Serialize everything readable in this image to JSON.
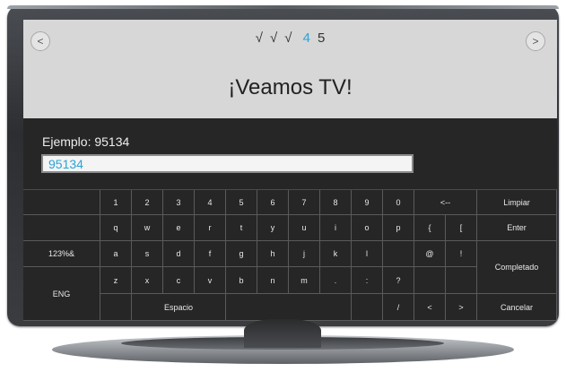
{
  "steps": [
    "√",
    "√",
    "√",
    "4",
    "5"
  ],
  "current_step": "4",
  "nav": {
    "prev": "<",
    "next": ">"
  },
  "title": "¡Veamos TV!",
  "example": "Ejemplo: 95134",
  "code_value": "95134",
  "keys": [
    [
      "",
      "1",
      "2",
      "3",
      "4",
      "5",
      "6",
      "7",
      "8",
      "9",
      "0",
      "<--",
      "Limpiar"
    ],
    [
      "",
      "q",
      "w",
      "e",
      "r",
      "t",
      "y",
      "u",
      "i",
      "o",
      "p",
      "{",
      "[",
      "Enter"
    ],
    [
      "123%&",
      "a",
      "s",
      "d",
      "f",
      "g",
      "h",
      "j",
      "k",
      "l",
      "",
      "@",
      "!",
      "Completado"
    ],
    [
      "",
      "z",
      "x",
      "c",
      "v",
      "b",
      "n",
      "m",
      ".",
      ":",
      "?",
      "",
      ""
    ],
    [
      "ENG",
      "",
      "Espacio",
      "",
      "",
      "/",
      "<",
      "",
      ">",
      "Cancelar"
    ]
  ],
  "colors": {
    "accent": "#2ba3d9",
    "screen_bg": "#262626",
    "topbar_bg": "#d7d7d7"
  },
  "icons": {
    "prev": "chevron-left-icon",
    "next": "chevron-right-icon"
  }
}
